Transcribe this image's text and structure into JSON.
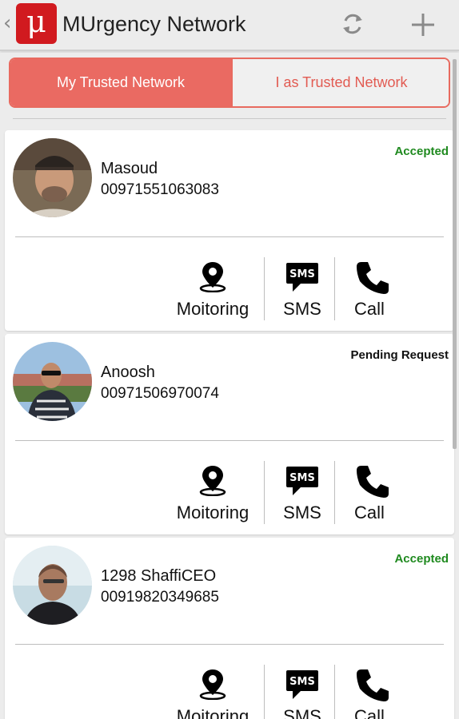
{
  "app": {
    "title": "MUrgency Network",
    "logo_glyph": "μ",
    "back_glyph": "‹",
    "brand_color": "#d11a1f"
  },
  "toolbar": {
    "refresh_icon": "refresh-icon",
    "add_icon": "plus-icon"
  },
  "tabs": [
    {
      "label": "My Trusted Network",
      "active": true
    },
    {
      "label": "I as Trusted Network",
      "active": false
    }
  ],
  "colors": {
    "accent": "#ea6a62",
    "accepted": "#1f8a1f",
    "pending": "#111111"
  },
  "contacts": [
    {
      "name": "Masoud",
      "phone": "00971551063083",
      "status": "Accepted",
      "actions": {
        "monitoring": "Moitoring",
        "sms": "SMS",
        "call": "Call"
      }
    },
    {
      "name": "Anoosh",
      "phone": "00971506970074",
      "status": "Pending Request",
      "actions": {
        "monitoring": "Moitoring",
        "sms": "SMS",
        "call": "Call"
      }
    },
    {
      "name": "1298 ShaffiCEO",
      "phone": "00919820349685",
      "status": "Accepted",
      "actions": {
        "monitoring": "Moitoring",
        "sms": "SMS",
        "call": "Call"
      }
    }
  ],
  "sms_badge_text": "SMS"
}
